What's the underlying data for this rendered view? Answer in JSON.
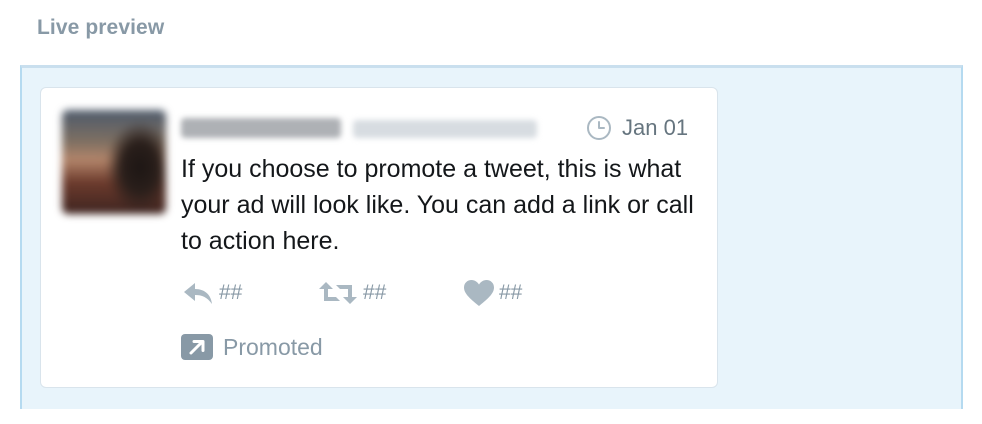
{
  "section": {
    "title": "Live preview"
  },
  "tweet": {
    "timestamp": "Jan 01",
    "text": "If you choose to promote a tweet, this is what your ad will look like. You can add a link or call to action here.",
    "actions": {
      "reply_count": "##",
      "retweet_count": "##",
      "like_count": "##"
    },
    "promoted_label": "Promoted"
  },
  "icons": {
    "timestamp": "clock-icon",
    "reply": "reply-icon",
    "retweet": "retweet-icon",
    "like": "heart-icon",
    "promoted": "promoted-arrow-icon"
  },
  "colors": {
    "section_title": "#8899a6",
    "preview_background": "#e8f4fb",
    "preview_border": "#b5daf0",
    "card_border": "#d9e4ec",
    "tweet_text": "#14171a",
    "meta_text": "#8899a6",
    "icon_gray": "#aab8c2",
    "badge_gray": "#8899a6"
  }
}
